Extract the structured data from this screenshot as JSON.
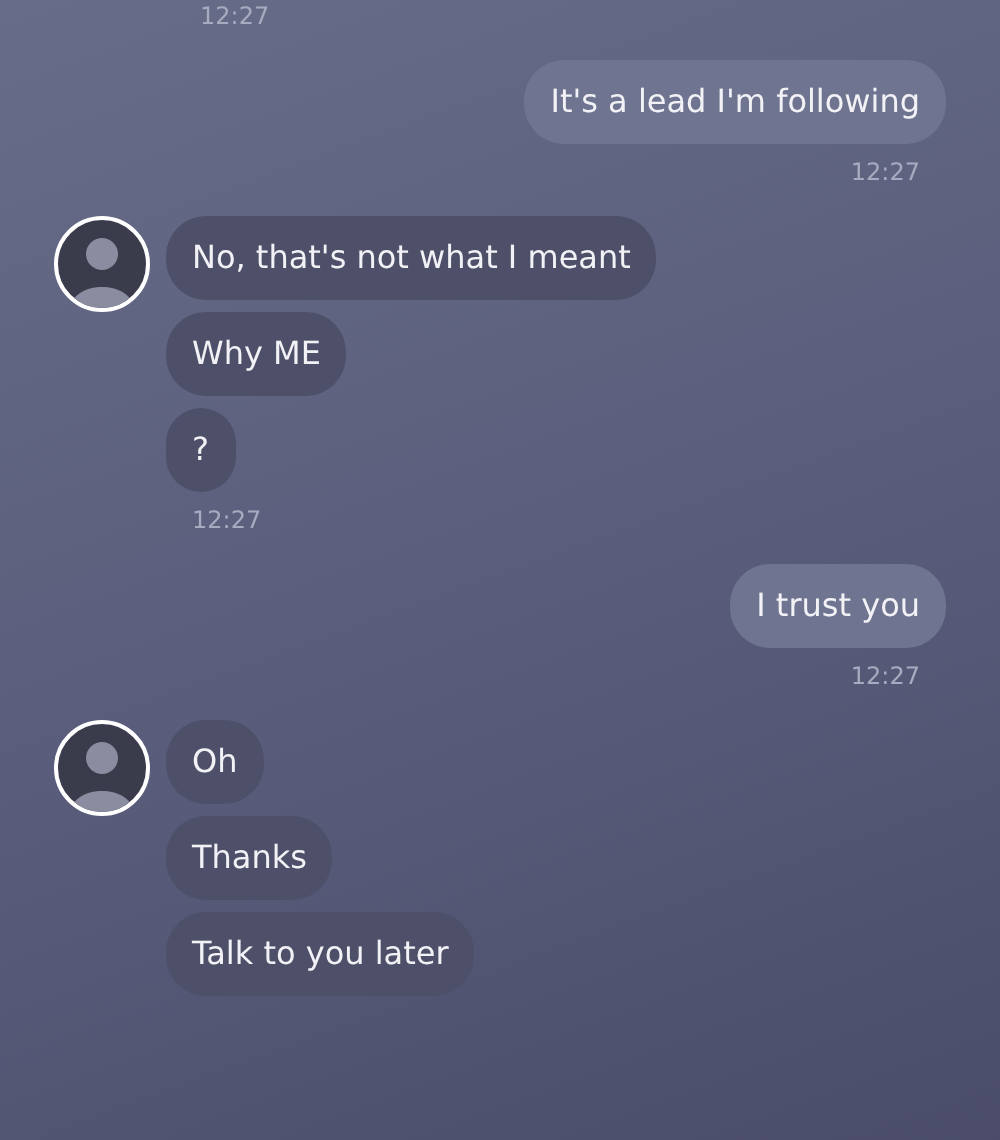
{
  "messages": [
    {
      "kind": "incoming",
      "time": "12:27"
    },
    {
      "kind": "outgoing",
      "bubbles": [
        "It's a lead I'm following"
      ],
      "time": "12:27"
    },
    {
      "kind": "incoming",
      "bubbles": [
        "No, that's not what I meant",
        "Why ME",
        "?"
      ],
      "time": "12:27"
    },
    {
      "kind": "outgoing",
      "bubbles": [
        "I trust you"
      ],
      "time": "12:27"
    },
    {
      "kind": "incoming",
      "bubbles": [
        "Oh",
        "Thanks",
        "Talk to you later"
      ]
    }
  ]
}
